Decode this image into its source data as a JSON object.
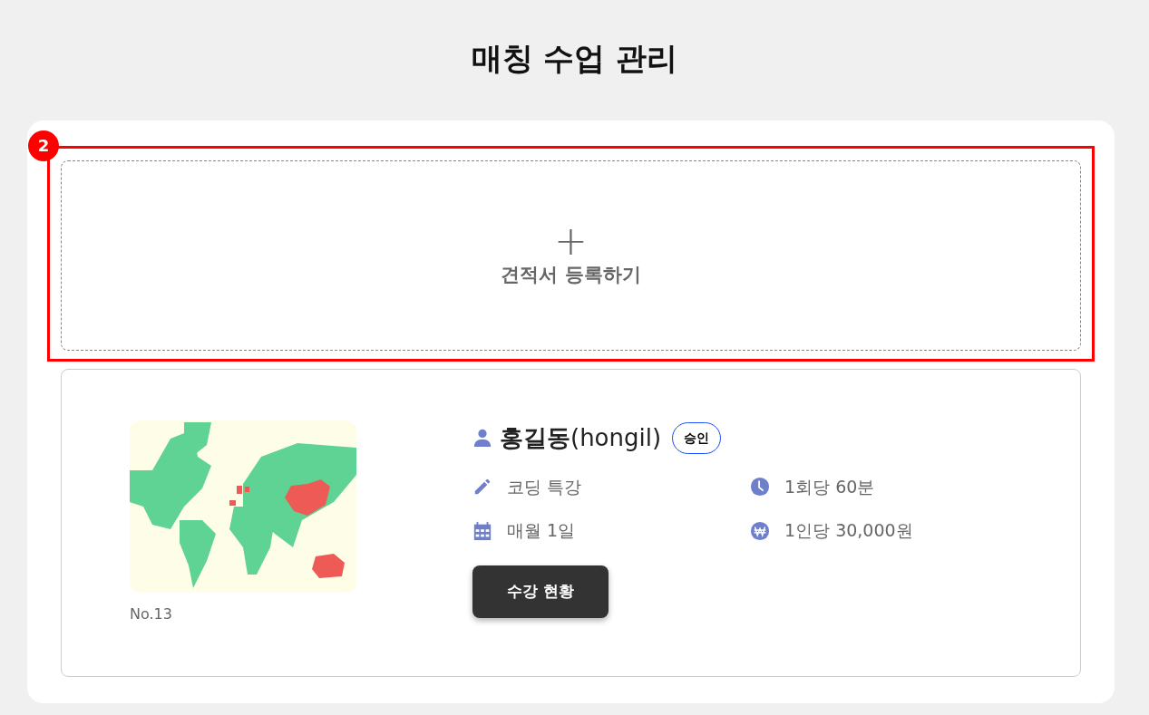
{
  "page_title": "매칭 수업 관리",
  "annotation": {
    "label": "2"
  },
  "add_quote": {
    "icon": "+",
    "label": "견적서 등록하기"
  },
  "classes": [
    {
      "number": "No.13",
      "teacher": "홍길동",
      "teacher_id": "(hongil)",
      "status": "승인",
      "details": [
        {
          "kind": "pencil",
          "text": "코딩 특강"
        },
        {
          "kind": "clock",
          "text": "1회당 60분"
        },
        {
          "kind": "calendar",
          "text": "매월 1일"
        },
        {
          "kind": "won",
          "text": "1인당 30,000원"
        }
      ],
      "button": "수강 현황"
    }
  ]
}
